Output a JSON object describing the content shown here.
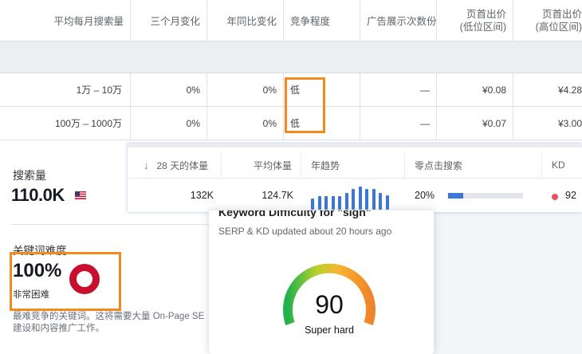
{
  "keyword_table": {
    "headers": {
      "avg_monthly_searches": "平均每月搜索量",
      "three_month_change": "三个月变化",
      "yoy_change": "年同比变化",
      "competition": "竞争程度",
      "ad_impression_share": "广告展示次数份",
      "top_bid_low_line1": "页首出价",
      "top_bid_low_line2": "(低位区间)",
      "top_bid_high_line1": "页首出价",
      "top_bid_high_line2": "(高位区间)"
    },
    "rows": [
      {
        "searches": "1万 – 10万",
        "three_month": "0%",
        "yoy": "0%",
        "competition": "低",
        "impression_share": "—",
        "bid_low": "¥0.08",
        "bid_high": "¥4.28"
      },
      {
        "searches": "100万 – 1000万",
        "three_month": "0%",
        "yoy": "0%",
        "competition": "低",
        "impression_share": "—",
        "bid_low": "¥0.07",
        "bid_high": "¥3.00"
      }
    ]
  },
  "semrush": {
    "search_volume_label": "搜索量",
    "search_volume_value": "110.0K",
    "kd_label": "关键词难度",
    "kd_value": "100%",
    "kd_sub": "非常困难",
    "kd_desc_line1": "最难竞争的关键词。这将需要大量 On-Page SE",
    "kd_desc_line2": "建设和内容推广工作。",
    "flag_icon": "us-flag-icon",
    "ring_color": "#c8102e"
  },
  "metrics_bar": {
    "headers": {
      "volume_28d": "28 天的体量",
      "avg_volume": "平均体量",
      "yearly_trend": "年趋势",
      "zero_click": "零点击搜索",
      "kd": "KD"
    },
    "values": {
      "volume_28d": "132K",
      "avg_volume": "124.7K",
      "zero_click": "20%",
      "kd": "92"
    },
    "zero_click_fraction": 0.2,
    "trend_bars": [
      0.45,
      0.55,
      0.55,
      0.55,
      0.55,
      0.7,
      0.85,
      0.95,
      0.85,
      0.85,
      0.7,
      0.6
    ],
    "accent_color": "#3b77d6",
    "kd_dot_color": "#e05666"
  },
  "kd_popup": {
    "title": "Keyword Difficulty for \"sign\"",
    "updated": "SERP & KD updated about 20 hours ago",
    "score": "90",
    "label": "Super hard",
    "score_fraction": 0.9
  }
}
